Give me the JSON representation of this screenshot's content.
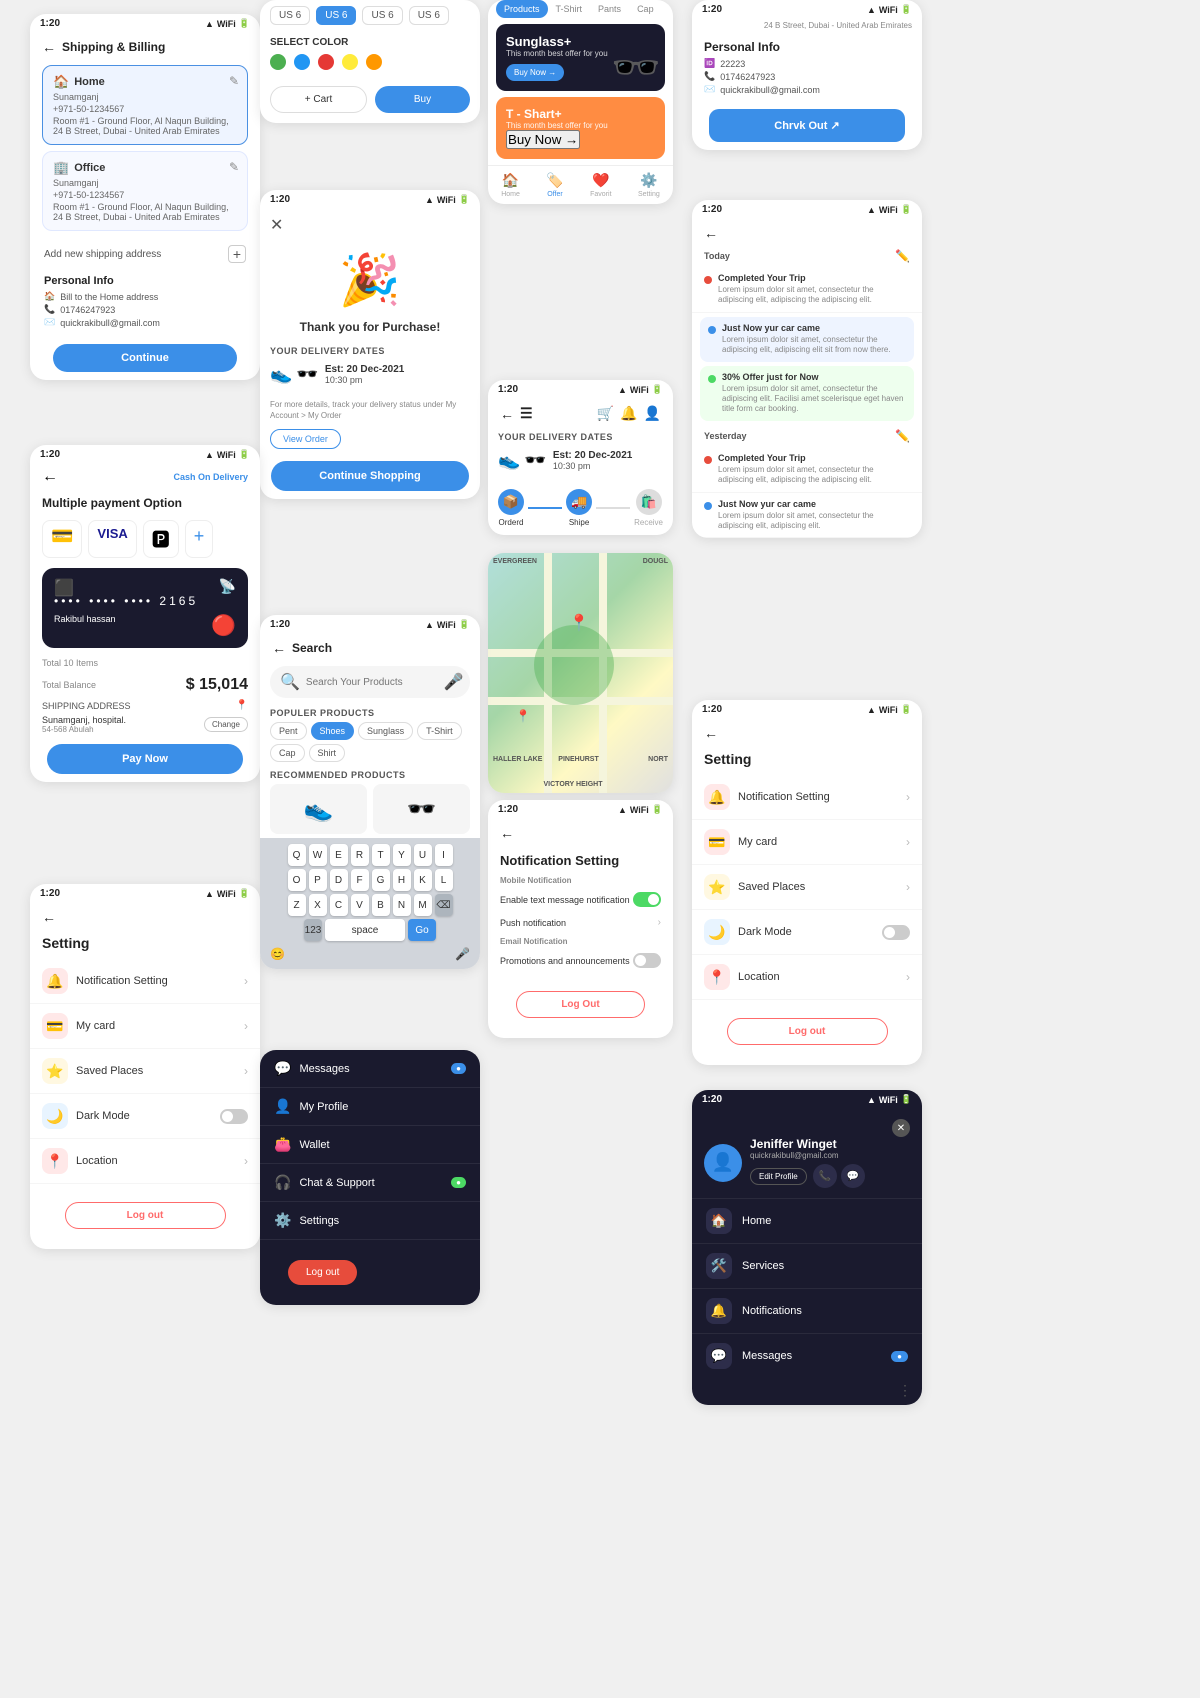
{
  "screens": {
    "shipping": {
      "statusBar": "1:20",
      "title": "Shipping & Billing",
      "homeAddress": {
        "label": "Home",
        "owner": "Sunamganj",
        "phone": "+971-50-1234567",
        "address": "Room #1 - Ground Floor, Al Naqun Building, 24 B Street, Dubai - United Arab Emirates"
      },
      "officeAddress": {
        "label": "Office",
        "owner": "Sunamganj",
        "phone": "+971-50-1234567",
        "address": "Room #1 - Ground Floor, Al Naqun Building, 24 B Street, Dubai - United Arab Emirates"
      },
      "addNew": "Add new shipping address",
      "personalInfo": {
        "title": "Personal Info",
        "bill": "Bill to the Home address",
        "phone": "01746247923",
        "email": "quickrakibull@gmail.com"
      },
      "continueBtn": "Continue"
    },
    "colorSelect": {
      "sizes": [
        "US 6",
        "US 6",
        "US 6",
        "US 6"
      ],
      "selectColorLabel": "SELECT COLOR",
      "colors": [
        "#4caf50",
        "#2196f3",
        "#e53935",
        "#ffeb3b",
        "#ff9800"
      ],
      "cartBtn": "+ Cart",
      "buyBtn": "Buy"
    },
    "thankYou": {
      "statusBar": "1:20",
      "message": "Thank you for Purchase!",
      "deliveryDatesLabel": "YOUR DELIVERY DATES",
      "estimatedDate": "Est: 20 Dec-2021",
      "estimatedTime": "10:30 pm",
      "note": "For more details, track your delivery status under My Account > My Order",
      "viewOrderBtn": "View Order",
      "continueBtn": "Continue Shopping"
    },
    "products": {
      "tabs": [
        "Products",
        "T-Shirt",
        "Pants",
        "Cap"
      ],
      "banner1": {
        "title": "Sunglass+",
        "subtitle": "This month best offer for you",
        "buyBtn": "Buy Now →"
      },
      "banner2": {
        "title": "T - Shart+",
        "subtitle": "This month best offer for you",
        "buyBtn": "Buy Now →"
      },
      "navItems": [
        "Home",
        "Offer",
        "Favorit",
        "Setting"
      ]
    },
    "deliveryProd": {
      "statusBar": "1:20",
      "deliveryDatesLabel": "YOUR DELIVERY DATES",
      "estimatedDate": "Est: 20 Dec-2021",
      "estimatedTime": "10:30 pm",
      "steps": [
        "Orderd",
        "Shipe",
        "Receive"
      ]
    },
    "notifSetting": {
      "statusBar": "1:20",
      "title": "Notification Setting",
      "mobileSection": "Mobile Notification",
      "enableText": "Enable text message notification",
      "pushNotif": "Push notification",
      "emailSection": "Email Notification",
      "promotions": "Promotions and announcements",
      "logOutBtn": "Log Out"
    },
    "payment": {
      "statusBar": "1:20",
      "cashOnDelivery": "Cash On Delivery",
      "title": "Multiple payment Option",
      "cardNum": "•••• •••• •••• 2165",
      "cardHolder": "Rakibul hassan",
      "totalItems": "Total 10 Items",
      "totalBalance": "Total Balance",
      "totalAmount": "$ 15,014",
      "shippingAddress": "SHIPPING ADDRESS",
      "shippingLoc": "Sunamganj, hospital.",
      "shippingCode": "54-568 Abulah",
      "changeBtn": "Change",
      "payNowBtn": "Pay Now"
    },
    "settingLeft": {
      "statusBar": "1:20",
      "title": "Setting",
      "items": [
        {
          "label": "Notification Setting",
          "icon": "🔔",
          "color": "#ffe8e8"
        },
        {
          "label": "My card",
          "icon": "💳",
          "color": "#ffe8e8"
        },
        {
          "label": "Saved Places",
          "icon": "⭐",
          "color": "#fff8e1"
        },
        {
          "label": "Dark Mode",
          "icon": "🌙",
          "color": "#e8f4ff"
        },
        {
          "label": "Location",
          "icon": "📍",
          "color": "#ffe8e8"
        }
      ],
      "logOutBtn": "Log out"
    },
    "search": {
      "statusBar": "1:20",
      "title": "Search",
      "placeholder": "Search Your Products",
      "popularLabel": "POPULER PRODUCTS",
      "popularTags": [
        "Pent",
        "Shoes",
        "Sunglass",
        "T-Shirt",
        "Cap",
        "Shirt"
      ],
      "recommendedLabel": "RECOMMENDED PRODUCTS",
      "keyboardRows": [
        [
          "Q",
          "W",
          "E",
          "R",
          "T",
          "Y",
          "U",
          "I"
        ],
        [
          "O",
          "P",
          "D",
          "F",
          "G",
          "H",
          "K",
          "L"
        ],
        [
          "Z",
          "X",
          "C",
          "V",
          "B",
          "N",
          "M",
          "⌫"
        ]
      ],
      "numRow": [
        "123",
        "space",
        "Go"
      ]
    },
    "menu": {
      "items": [
        {
          "label": "Messages",
          "icon": "💬",
          "badge": true,
          "badgeColor": "blue"
        },
        {
          "label": "My Profile",
          "icon": "👤",
          "badge": false
        },
        {
          "label": "Wallet",
          "icon": "👛",
          "badge": false
        },
        {
          "label": "Chat & Support",
          "icon": "🎧",
          "badge": true,
          "badgeColor": "green"
        },
        {
          "label": "Settings",
          "icon": "⚙️",
          "badge": false
        }
      ],
      "logOutBtn": "Log out"
    },
    "profile": {
      "address": "24 B Street, Dubai - United Arab Emirates",
      "personalInfo": "Personal Info",
      "fields": {
        "id": "22223",
        "phone": "01746247923",
        "email": "quickrakibull@gmail.com"
      },
      "chrvkBtn": "Chrvk Out ↗"
    },
    "notifFeed": {
      "statusBar": "1:20",
      "todayLabel": "Today",
      "items": [
        {
          "type": "red",
          "title": "Completed Your Trip",
          "body": "Lorem ipsum dolor sit amet, consectetur the adipiscing elit, adipiscing the adipiscing elit."
        },
        {
          "type": "blue",
          "title": "Just Now yur car came",
          "body": "Lorem ipsum dolor sit amet, consectetur the adipiscing elit, adipiscing elit sit from now there."
        },
        {
          "type": "green",
          "title": "30% Offer just for Now",
          "body": "Lorem ipsum dolor sit amet, consectetur the adipiscing elit. Facilisi amet scelerisque eget haven title form car booking."
        }
      ],
      "yesterdayLabel": "Yesterday",
      "yesterdayItems": [
        {
          "type": "red",
          "title": "Completed Your Trip",
          "body": "Lorem ipsum dolor sit amet, consectetur the adipiscing elit, adipiscing the adipiscing elit."
        },
        {
          "type": "blue",
          "title": "Just Now yur car came",
          "body": "Lorem ipsum dolor sit amet, consectetur the adipiscing elit, adipiscing elit."
        }
      ]
    },
    "settingRight": {
      "statusBar": "1:20",
      "title": "Setting",
      "items": [
        {
          "label": "Notification Setting",
          "icon": "🔔",
          "color": "#ffe8e8"
        },
        {
          "label": "My card",
          "icon": "💳",
          "color": "#ffe8e8"
        },
        {
          "label": "Saved Places",
          "icon": "⭐",
          "color": "#fff8e1"
        },
        {
          "label": "Dark Mode",
          "icon": "🌙",
          "color": "#e8f4ff",
          "hasToggle": true
        },
        {
          "label": "Location",
          "icon": "📍",
          "color": "#ffe8e8"
        }
      ]
    },
    "profileBottom": {
      "statusBar": "1:20",
      "name": "Jeniffer Winget",
      "email": "quickrakibull@gmail.com",
      "editBtn": "Edit Profile",
      "menuItems": [
        {
          "label": "Home",
          "icon": "🏠"
        },
        {
          "label": "Services",
          "icon": "🛠️"
        },
        {
          "label": "Notifications",
          "icon": "🔔"
        },
        {
          "label": "Messages",
          "icon": "💬",
          "badge": true
        }
      ]
    }
  }
}
